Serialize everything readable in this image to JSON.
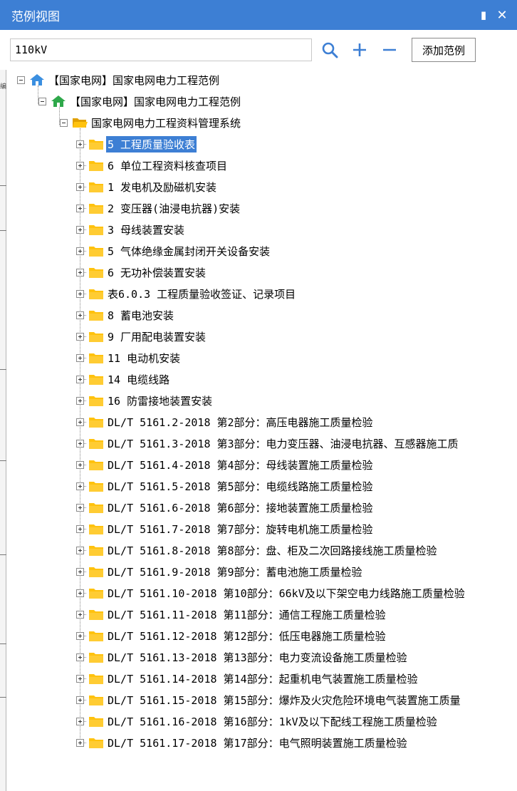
{
  "window": {
    "title": "范例视图",
    "pin_icon": "pin-icon",
    "close_icon": "close-icon"
  },
  "toolbar": {
    "search_value": "110kV",
    "search_icon": "search-icon",
    "zoom_in_icon": "plus-icon",
    "zoom_out_icon": "minus-icon",
    "add_button_label": "添加范例"
  },
  "colors": {
    "title_bar": "#3d7fd4",
    "selection": "#3d7fd4",
    "home_blue": "#3b8fe0",
    "home_green": "#2ea84a",
    "folder": "#ffc20e"
  },
  "left_strip": {
    "label": "编"
  },
  "tree": {
    "root": {
      "label": "【国家电网】国家电网电力工程范例",
      "icon": "home-icon"
    },
    "child": {
      "label": "【国家电网】国家电网电力工程范例",
      "icon": "home-icon"
    },
    "system": {
      "label": "国家电网电力工程资料管理系统",
      "icon": "folder-open-icon"
    },
    "items": [
      {
        "label": "5 工程质量验收表",
        "selected": true
      },
      {
        "label": "6 单位工程资料核查项目"
      },
      {
        "label": "1 发电机及励磁机安装"
      },
      {
        "label": "2 变压器(油浸电抗器)安装"
      },
      {
        "label": "3 母线装置安装"
      },
      {
        "label": "5 气体绝缘金属封闭开关设备安装"
      },
      {
        "label": "6 无功补偿装置安装"
      },
      {
        "label": "表6.0.3 工程质量验收签证、记录项目"
      },
      {
        "label": "8 蓄电池安装"
      },
      {
        "label": "9 厂用配电装置安装"
      },
      {
        "label": "11 电动机安装"
      },
      {
        "label": "14 电缆线路"
      },
      {
        "label": "16 防雷接地装置安装"
      },
      {
        "label": "DL/T 5161.2-2018 第2部分：高压电器施工质量检验"
      },
      {
        "label": "DL/T 5161.3-2018 第3部分：电力变压器、油浸电抗器、互感器施工质"
      },
      {
        "label": "DL/T 5161.4-2018 第4部分：母线装置施工质量检验"
      },
      {
        "label": "DL/T 5161.5-2018 第5部分：电缆线路施工质量检验"
      },
      {
        "label": "DL/T 5161.6-2018 第6部分：接地装置施工质量检验"
      },
      {
        "label": "DL/T 5161.7-2018 第7部分：旋转电机施工质量检验"
      },
      {
        "label": "DL/T 5161.8-2018 第8部分：盘、柜及二次回路接线施工质量检验"
      },
      {
        "label": "DL/T 5161.9-2018 第9部分：蓄电池施工质量检验"
      },
      {
        "label": "DL/T 5161.10-2018 第10部分：66kV及以下架空电力线路施工质量检验"
      },
      {
        "label": "DL/T 5161.11-2018 第11部分：通信工程施工质量检验"
      },
      {
        "label": "DL/T 5161.12-2018 第12部分：低压电器施工质量检验"
      },
      {
        "label": "DL/T 5161.13-2018 第13部分：电力变流设备施工质量检验"
      },
      {
        "label": "DL/T 5161.14-2018 第14部分：起重机电气装置施工质量检验"
      },
      {
        "label": "DL/T 5161.15-2018 第15部分：爆炸及火灾危险环境电气装置施工质量"
      },
      {
        "label": "DL/T 5161.16-2018 第16部分：1kV及以下配线工程施工质量检验"
      },
      {
        "label": "DL/T 5161.17-2018 第17部分：电气照明装置施工质量检验"
      }
    ]
  }
}
